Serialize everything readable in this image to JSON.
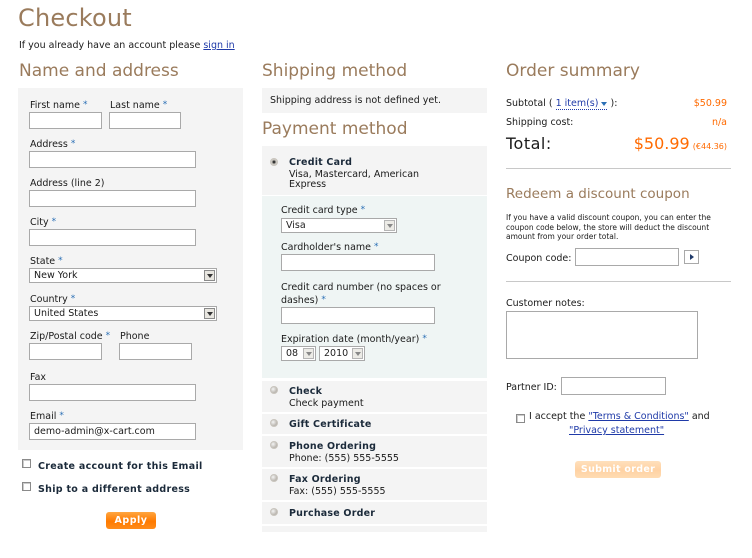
{
  "page": {
    "title": "Checkout",
    "signin_prefix": "If you already have an account please",
    "signin_link": "sign in"
  },
  "address": {
    "heading": "Name and address",
    "first_name_label": "First name",
    "last_name_label": "Last name",
    "address_label": "Address",
    "address2_label": "Address (line 2)",
    "city_label": "City",
    "state_label": "State",
    "state_value": "New York",
    "country_label": "Country",
    "country_value": "United States",
    "zip_label": "Zip/Postal code",
    "phone_label": "Phone",
    "fax_label": "Fax",
    "email_label": "Email",
    "email_value": "demo-admin@x-cart.com",
    "required_mark": "*",
    "create_account_label": "Create account for this Email",
    "ship_different_label": "Ship to a different address",
    "apply_button": "Apply"
  },
  "shipping": {
    "heading": "Shipping method",
    "message": "Shipping address is not defined yet."
  },
  "payment": {
    "heading": "Payment method",
    "selected": "Credit Card",
    "methods": [
      {
        "title": "Credit Card",
        "desc_line1": "Visa, Mastercard, American",
        "desc_line2": "Express",
        "selected": true
      },
      {
        "title": "Check",
        "desc_line1": "Check payment",
        "selected": false
      },
      {
        "title": "Gift Certificate",
        "selected": false
      },
      {
        "title": "Phone Ordering",
        "desc_line1": "Phone: (555) 555-5555",
        "selected": false
      },
      {
        "title": "Fax Ordering",
        "desc_line1": "Fax: (555) 555-5555",
        "selected": false
      },
      {
        "title": "Purchase Order",
        "selected": false
      }
    ],
    "credit_card": {
      "type_label": "Credit card type",
      "type_value": "Visa",
      "holder_label": "Cardholder's name",
      "number_label_line1": "Credit card number (no spaces or",
      "number_label_line2": "dashes)",
      "expiration_label": "Expiration date (month/year)",
      "exp_month": "08",
      "exp_year": "2010"
    }
  },
  "summary": {
    "heading": "Order summary",
    "subtotal_label_prefix": "Subtotal (",
    "items_link": "1 item(s)",
    "subtotal_label_suffix": "):",
    "subtotal_value": "$50.99",
    "shipping_label": "Shipping cost:",
    "shipping_value": "n/a",
    "total_label": "Total:",
    "total_value": "$50.99",
    "total_alt_currency": "(€44.36)",
    "price_color": "#ff6a00"
  },
  "coupon": {
    "heading": "Redeem a discount coupon",
    "description": "If you have a valid discount coupon, you can enter the coupon code below, the store will deduct the discount amount from your order total.",
    "code_label": "Coupon code:"
  },
  "order": {
    "notes_label": "Customer notes:",
    "partner_label": "Partner ID:",
    "accept_prefix": "I accept the",
    "terms_link": "\"Terms & Conditions\"",
    "accept_and": "and",
    "privacy_link": "\"Privacy statement\"",
    "submit_button": "Submit order"
  }
}
